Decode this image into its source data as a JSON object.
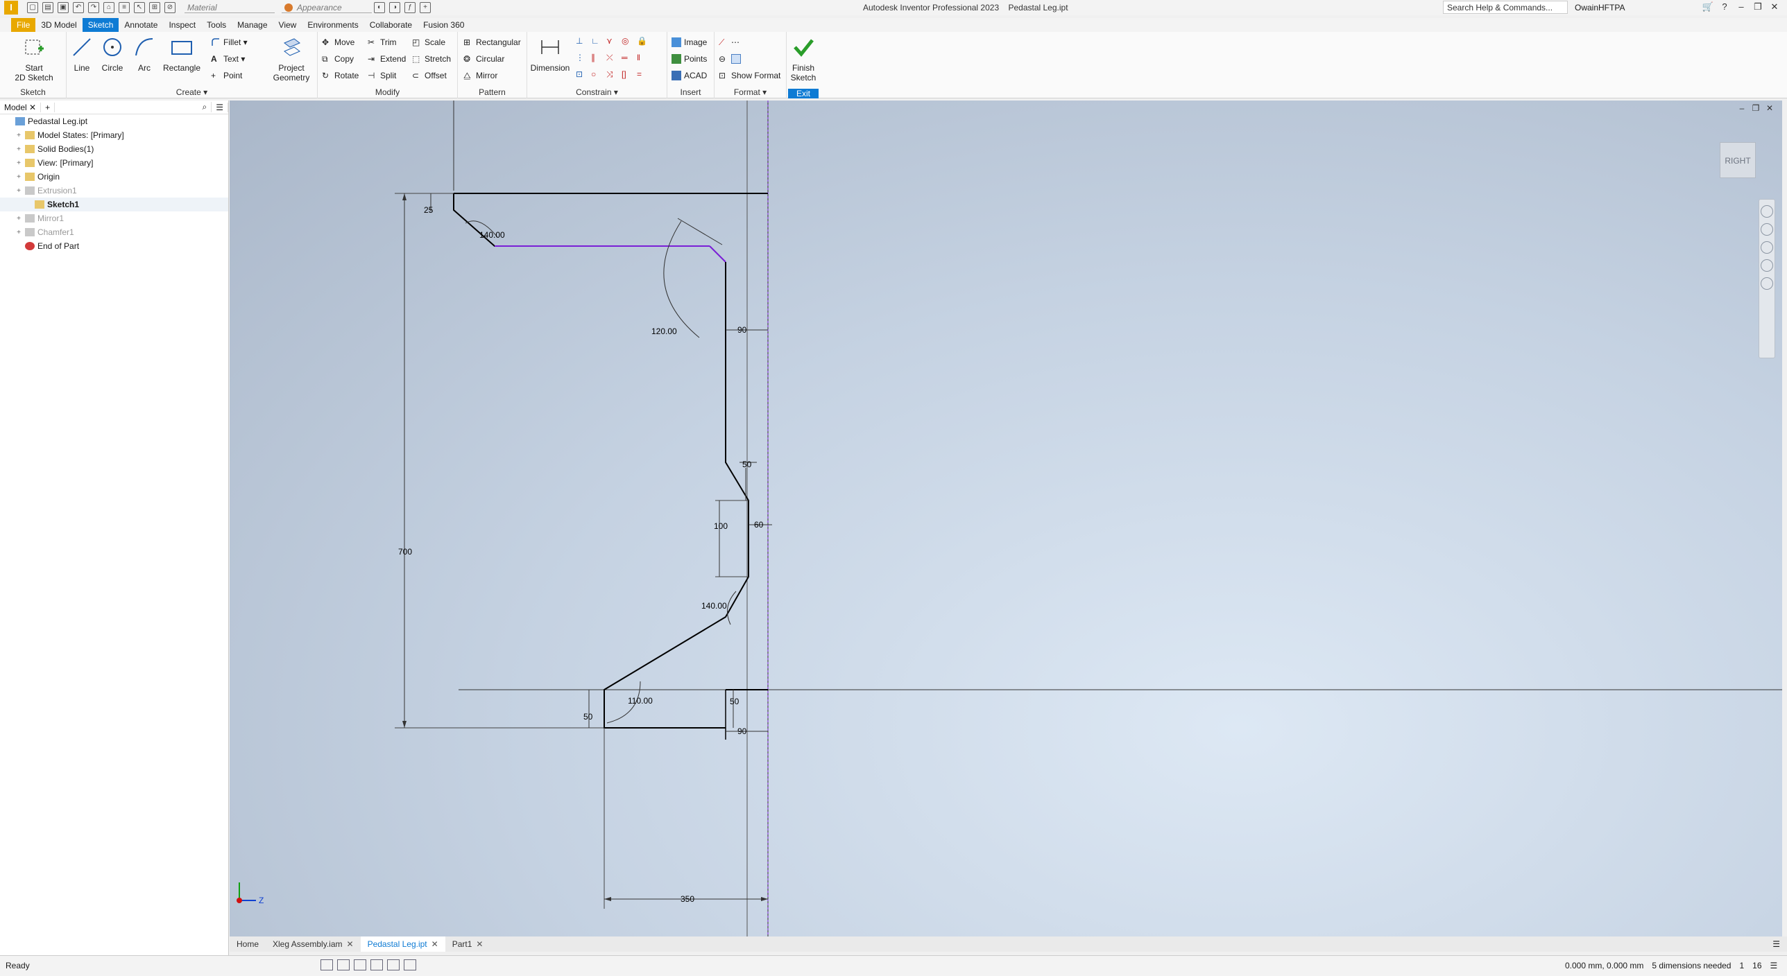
{
  "app": {
    "logo_letter": "I",
    "title": "Autodesk Inventor Professional 2023",
    "document": "Pedastal Leg.ipt",
    "material_placeholder": "Material",
    "appearance_placeholder": "Appearance",
    "search_placeholder": "Search Help & Commands...",
    "user": "OwainHFTPA"
  },
  "menu_tabs": [
    "File",
    "3D Model",
    "Sketch",
    "Annotate",
    "Inspect",
    "Tools",
    "Manage",
    "View",
    "Environments",
    "Collaborate",
    "Fusion 360"
  ],
  "active_tab": "Sketch",
  "ribbon": {
    "sketch_panel": {
      "title": "Sketch",
      "start_2d_sketch": [
        "Start",
        "2D Sketch"
      ]
    },
    "create_panel": {
      "title": "Create",
      "line": "Line",
      "circle": "Circle",
      "arc": "Arc",
      "rectangle": "Rectangle",
      "fillet": "Fillet",
      "text": "Text",
      "point": "Point",
      "project_geometry": [
        "Project",
        "Geometry"
      ]
    },
    "modify_panel": {
      "title": "Modify",
      "move": "Move",
      "copy": "Copy",
      "rotate": "Rotate",
      "trim": "Trim",
      "extend": "Extend",
      "split": "Split",
      "scale": "Scale",
      "stretch": "Stretch",
      "offset": "Offset"
    },
    "pattern_panel": {
      "title": "Pattern",
      "rectangular": "Rectangular",
      "circular": "Circular",
      "mirror": "Mirror"
    },
    "constrain_panel": {
      "title": "Constrain",
      "dimension": "Dimension"
    },
    "insert_panel": {
      "title": "Insert",
      "image": "Image",
      "points": "Points",
      "acad": "ACAD"
    },
    "format_panel": {
      "title": "Format",
      "show_format": "Show Format"
    },
    "exit_panel": {
      "title": "Exit",
      "finish_sketch": [
        "Finish",
        "Sketch"
      ]
    }
  },
  "browser": {
    "tab": "Model",
    "items": [
      {
        "label": "Pedastal Leg.ipt",
        "level": 0,
        "state": "normal"
      },
      {
        "label": "Model States: [Primary]",
        "level": 1,
        "state": "normal"
      },
      {
        "label": "Solid Bodies(1)",
        "level": 1,
        "state": "normal"
      },
      {
        "label": "View: [Primary]",
        "level": 1,
        "state": "normal"
      },
      {
        "label": "Origin",
        "level": 1,
        "state": "normal"
      },
      {
        "label": "Extrusion1",
        "level": 1,
        "state": "dim"
      },
      {
        "label": "Sketch1",
        "level": 2,
        "state": "selected"
      },
      {
        "label": "Mirror1",
        "level": 1,
        "state": "dim"
      },
      {
        "label": "Chamfer1",
        "level": 1,
        "state": "dim"
      },
      {
        "label": "End of Part",
        "level": 1,
        "state": "normal"
      }
    ]
  },
  "viewcube": "RIGHT",
  "sketch": {
    "dimensions": {
      "d25": "25",
      "d140_top": "140.00",
      "d120": "120.00",
      "d90_top": "90",
      "d700": "700",
      "d50_mid": "50",
      "d100": "100",
      "d60": "60",
      "d140_mid": "140.00",
      "d110": "110.00",
      "d50_bottom_left": "50",
      "d50_bottom_right": "50",
      "d90_bottom": "90",
      "d350": "350"
    },
    "axis_labels": {
      "z": "Z"
    },
    "colors": {
      "profile": "#000000",
      "highlight": "#7a1fd6",
      "axis_x": "#d01010",
      "axis_y": "#10a010",
      "axis_z": "#1040d0"
    }
  },
  "doc_tabs": [
    {
      "label": "Home",
      "active": false,
      "closable": false
    },
    {
      "label": "Xleg Assembly.iam",
      "active": false,
      "closable": true
    },
    {
      "label": "Pedastal Leg.ipt",
      "active": true,
      "closable": true
    },
    {
      "label": "Part1",
      "active": false,
      "closable": true
    }
  ],
  "status": {
    "left": "Ready",
    "coords": "0.000 mm, 0.000 mm",
    "dims_needed": "5 dimensions needed",
    "count1": "1",
    "count2": "16"
  }
}
